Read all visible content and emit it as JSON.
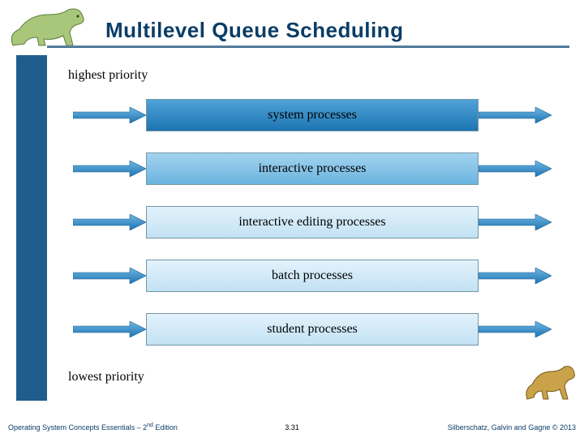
{
  "title": "Multilevel Queue Scheduling",
  "labels": {
    "highest": "highest priority",
    "lowest": "lowest priority"
  },
  "queues": [
    {
      "label": "system processes",
      "fill": "fill-dark"
    },
    {
      "label": "interactive processes",
      "fill": "fill-med"
    },
    {
      "label": "interactive editing processes",
      "fill": "fill-light"
    },
    {
      "label": "batch processes",
      "fill": "fill-light"
    },
    {
      "label": "student processes",
      "fill": "fill-light"
    }
  ],
  "footer": {
    "left_prefix": "Operating System Concepts Essentials – 2",
    "left_sup": "nd",
    "left_suffix": " Edition",
    "mid": "3.31",
    "right": "Silberschatz, Galvin and Gagne © 2013"
  },
  "icons": {
    "dino_top": "dinosaur-icon",
    "dino_bottom": "dinosaur-icon"
  }
}
